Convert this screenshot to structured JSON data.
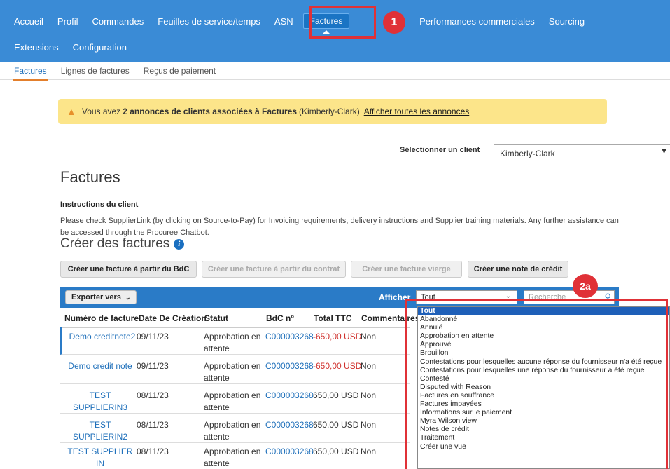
{
  "nav": {
    "row1": [
      "Accueil",
      "Profil",
      "Commandes",
      "Feuilles de service/temps",
      "ASN"
    ],
    "active": "Factures",
    "after_active_partial": "es",
    "row1_tail": [
      "Performances commerciales",
      "Sourcing"
    ],
    "row2": [
      "Extensions",
      "Configuration"
    ]
  },
  "callouts": {
    "badge1": "1",
    "badge2a": "2a",
    "color": "#e03137"
  },
  "subnav": [
    "Factures",
    "Lignes de factures",
    "Reçus de paiement"
  ],
  "notice": {
    "prefix": "Vous avez",
    "bold": "2 annonces de clients associées à Factures",
    "suffix": "(Kimberly-Clark)",
    "link": "Afficher toutes les annonces"
  },
  "client": {
    "label": "Sélectionner un client",
    "value": "Kimberly-Clark"
  },
  "page_title": "Factures",
  "instructions": {
    "title": "Instructions du client",
    "text": "Please check SupplierLink (by clicking on Source-to-Pay) for Invoicing requirements, delivery instructions and Supplier training materials. Any further assistance can be accessed through the Procuree Chatbot."
  },
  "create_title": "Créer des factures",
  "buttons": {
    "from_po": "Créer une facture à partir du BdC",
    "from_contract": "Créer une facture à partir du contrat",
    "blank": "Créer une facture vierge",
    "credit_note": "Créer une note de crédit"
  },
  "toolbar": {
    "export": "Exporter vers",
    "show_label": "Afficher",
    "filter_value": "Tout",
    "search_placeholder": "Recherche"
  },
  "table": {
    "headers": [
      "Numéro de facture",
      "Date De Création",
      "Statut",
      "BdC n°",
      "Total TTC",
      "Commentaires"
    ],
    "rows": [
      {
        "invoice": "Demo creditnote2",
        "date": "09/11/23",
        "status": "Approbation en attente",
        "po": "C000003268",
        "total": "-650,00 USD",
        "comments": "Non"
      },
      {
        "invoice": "Demo credit note",
        "date": "09/11/23",
        "status": "Approbation en attente",
        "po": "C000003268",
        "total": "-650,00 USD",
        "comments": "Non"
      },
      {
        "invoice": "TEST SUPPLIERIN3",
        "date": "08/11/23",
        "status": "Approbation en attente",
        "po": "C000003268",
        "total": "650,00 USD",
        "comments": "Non"
      },
      {
        "invoice": "TEST SUPPLIERIN2",
        "date": "08/11/23",
        "status": "Approbation en attente",
        "po": "C000003268",
        "total": "650,00 USD",
        "comments": "Non"
      },
      {
        "invoice": "TEST SUPPLIER IN",
        "date": "08/11/23",
        "status": "Approbation en attente",
        "po": "C000003268",
        "total": "650,00 USD",
        "comments": "Non"
      }
    ]
  },
  "dropdown_options": [
    "Tout",
    "Abandonné",
    "Annulé",
    "Approbation en attente",
    "Approuvé",
    "Brouillon",
    "Contestations pour lesquelles aucune réponse du fournisseur n'a été reçue",
    "Contestations pour lesquelles une réponse du fournisseur a été reçue",
    "Contesté",
    "Disputed with Reason",
    "Factures en souffrance",
    "Factures impayées",
    "Informations sur le paiement",
    "Myra Wilson view",
    "Notes de crédit",
    "Traitement",
    "Créer une vue"
  ]
}
